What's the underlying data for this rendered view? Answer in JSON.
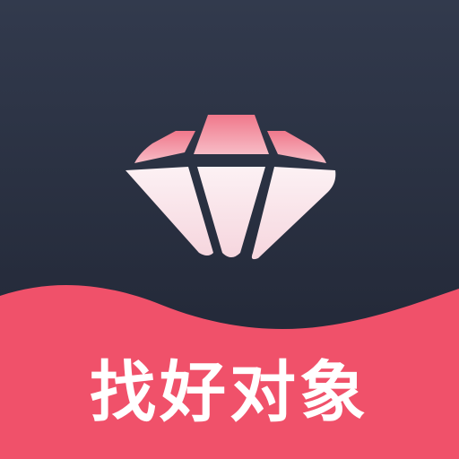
{
  "app_icon": {
    "logo_name": "diamond-logo-icon",
    "caption": "找好对象",
    "colors": {
      "background_top": "#323a4d",
      "background_bottom": "#1e2331",
      "wave": "#f0516a",
      "diamond_light": "#fbeef1",
      "diamond_pink": "#f27a8c",
      "caption_text": "#ffffff"
    }
  }
}
